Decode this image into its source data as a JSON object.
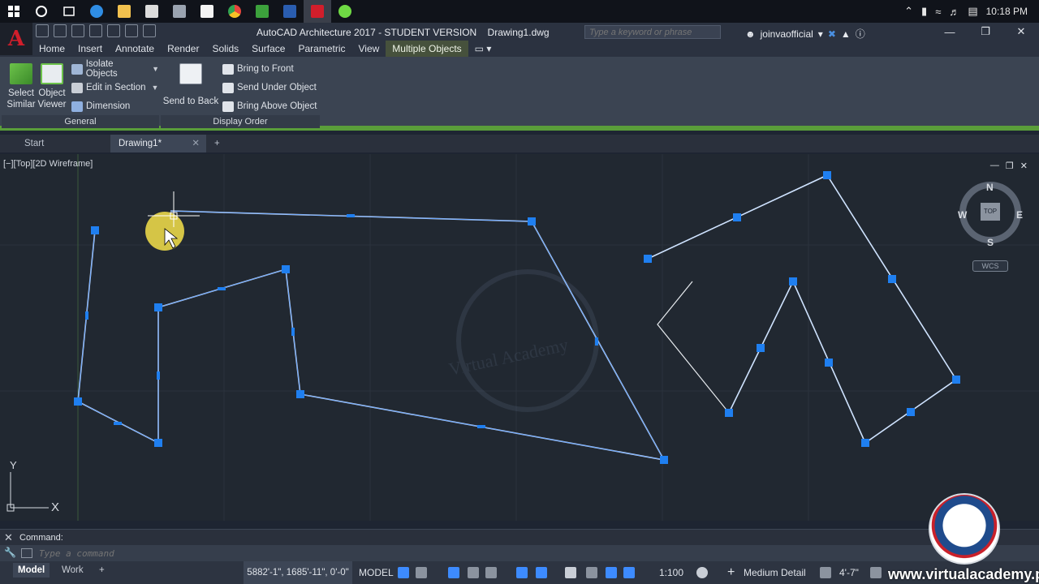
{
  "taskbar": {
    "icons": [
      {
        "name": "windows-start-icon",
        "color": "#ffffff"
      },
      {
        "name": "cortana-search-icon",
        "color": "#ffffff"
      },
      {
        "name": "task-view-icon",
        "color": "#ffffff"
      },
      {
        "name": "edge-browser-icon",
        "color": "#2f8de4"
      },
      {
        "name": "file-explorer-icon",
        "color": "#f2c14e"
      },
      {
        "name": "store-icon",
        "color": "#ffffff"
      },
      {
        "name": "calculator-icon",
        "color": "#dcdcdc"
      },
      {
        "name": "camtasia-icon",
        "color": "#ffffff"
      },
      {
        "name": "chrome-icon",
        "color": "#e8453c"
      },
      {
        "name": "camtasia-recorder-icon",
        "color": "#3ca13c"
      },
      {
        "name": "photoshop-icon",
        "color": "#2a5db0"
      },
      {
        "name": "autocad-taskbar-icon",
        "color": "#d11e2b"
      },
      {
        "name": "upwork-icon",
        "color": "#6fda44"
      }
    ],
    "clock": "10:18 PM"
  },
  "titlebar": {
    "app_title": "AutoCAD Architecture 2017 - STUDENT VERSION    Drawing1.dwg",
    "search_placeholder": "Type a keyword or phrase",
    "user": "joinvaofficial"
  },
  "ribbon": {
    "tabs": [
      "Home",
      "Insert",
      "Annotate",
      "Render",
      "Solids",
      "Surface",
      "Parametric",
      "View",
      "Multiple Objects"
    ],
    "active_tab": "Multiple Objects",
    "general_panel": {
      "title": "General",
      "select_similar": "Select\nSimilar",
      "select_similar_l1": "Select",
      "select_similar_l2": "Similar",
      "object_viewer_l1": "Object",
      "object_viewer_l2": "Viewer",
      "isolate_objects": "Isolate Objects",
      "edit_in_section": "Edit in Section",
      "dimension": "Dimension"
    },
    "display_order_panel": {
      "title": "Display Order",
      "send_to_back": "Send to Back",
      "bring_to_front": "Bring to Front",
      "send_under_object": "Send Under Object",
      "bring_above_object": "Bring Above Object"
    }
  },
  "file_tabs": {
    "start": "Start",
    "drawing": "Drawing1*"
  },
  "viewport": {
    "label": "[−][Top][2D Wireframe]",
    "viewcube": {
      "n": "N",
      "s": "S",
      "e": "E",
      "w": "W",
      "top": "TOP"
    },
    "wcs": "WCS",
    "ucs_x": "X",
    "ucs_y": "Y",
    "watermark_text": "Virtual Academy"
  },
  "command": {
    "label": "Command:",
    "placeholder": "Type a command"
  },
  "statusbar": {
    "layout_tabs": [
      "Model",
      "Work"
    ],
    "coords": "5882'-1\", 1685'-11\", 0'-0\"",
    "model": "MODEL",
    "scale": "1:100",
    "detail": "Medium Detail",
    "elevation": "4'-7\""
  },
  "branding": {
    "site": "www.virtualacademy.pk"
  },
  "colors": {
    "accent_selection": "#1f7ff0",
    "context_tab_green": "#5a9e3a",
    "canvas_bg": "#212831"
  }
}
